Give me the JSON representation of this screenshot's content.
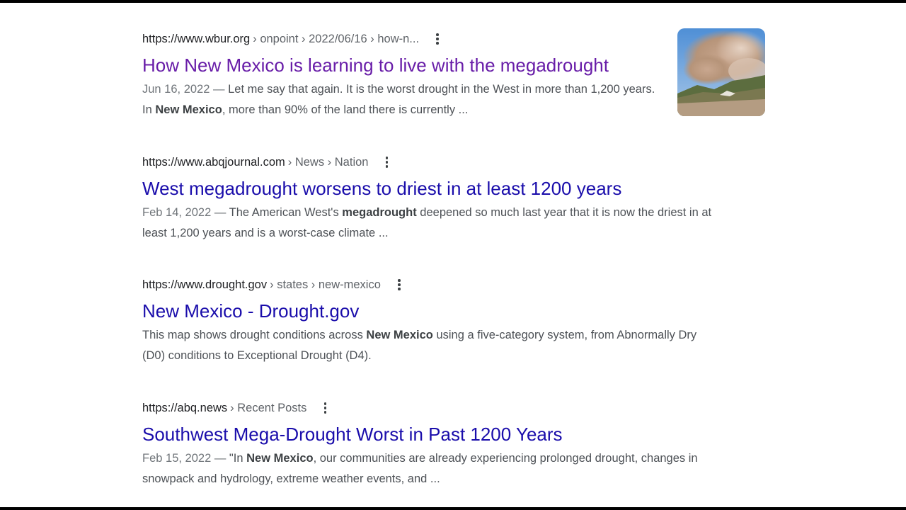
{
  "results": [
    {
      "domain": "https://www.wbur.org",
      "crumbs": "› onpoint › 2022/06/16 › how-n...",
      "title": "How New Mexico is learning to live with the megadrought",
      "date": "Jun 16, 2022",
      "sep": " — ",
      "snippet_parts": [
        "Let me say that again. It is the worst drought in the West in more than 1,200 years. In ",
        "New Mexico",
        ", more than 90% of the land there is currently ..."
      ],
      "visited": true
    },
    {
      "domain": "https://www.abqjournal.com",
      "crumbs": "› News › Nation",
      "title": "West megadrought worsens to driest in at least 1200 years",
      "date": "Feb 14, 2022",
      "sep": " — ",
      "snippet_parts": [
        "The American West's ",
        "megadrought",
        " deepened so much last year that it is now the driest in at least 1,200 years and is a worst-case climate ..."
      ]
    },
    {
      "domain": "https://www.drought.gov",
      "crumbs": "› states › new-mexico",
      "title": "New Mexico - Drought.gov",
      "snippet_parts": [
        "This map shows drought conditions across ",
        "New Mexico",
        " using a five-category system, from Abnormally Dry (D0) conditions to Exceptional Drought (D4)."
      ]
    },
    {
      "domain": "https://abq.news",
      "crumbs": "› Recent Posts",
      "title": "Southwest Mega-Drought Worst in Past 1200 Years",
      "date": "Feb 15, 2022",
      "sep": " — ",
      "snippet_parts": [
        "\"In ",
        "New Mexico",
        ", our communities are already experiencing prolonged drought, changes in snowpack and hydrology, extreme weather events, and ..."
      ]
    }
  ],
  "colors": {
    "link": "#1a0dab",
    "visited_link": "#681da8",
    "url_text": "#202124",
    "snippet_text": "#4d5156",
    "date_text": "#70757a"
  },
  "icons": {
    "more_options": "three-dot-vertical-icon",
    "thumbnail": "wildfire-smoke-thumbnail"
  }
}
